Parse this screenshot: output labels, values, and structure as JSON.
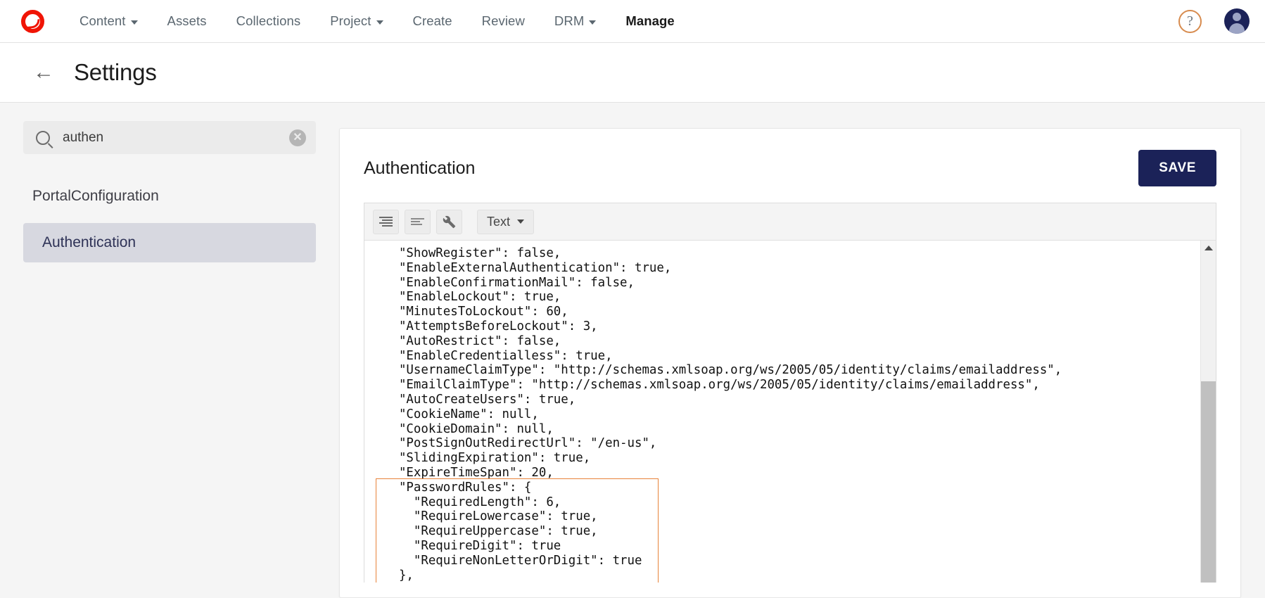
{
  "topnav": {
    "logo_name": "company-logo",
    "items": [
      {
        "label": "Content",
        "has_caret": true,
        "active": false
      },
      {
        "label": "Assets",
        "has_caret": false,
        "active": false
      },
      {
        "label": "Collections",
        "has_caret": false,
        "active": false
      },
      {
        "label": "Project",
        "has_caret": true,
        "active": false
      },
      {
        "label": "Create",
        "has_caret": false,
        "active": false
      },
      {
        "label": "Review",
        "has_caret": false,
        "active": false
      },
      {
        "label": "DRM",
        "has_caret": true,
        "active": false
      },
      {
        "label": "Manage",
        "has_caret": false,
        "active": true
      }
    ],
    "help_glyph": "?",
    "avatar_name": "user-avatar"
  },
  "pageheader": {
    "back_glyph": "←",
    "title": "Settings"
  },
  "sidebar": {
    "search": {
      "value": "authen",
      "placeholder": "Search",
      "clear_glyph": "✕"
    },
    "group_title": "PortalConfiguration",
    "items": [
      {
        "label": "Authentication",
        "selected": true
      }
    ]
  },
  "main": {
    "title": "Authentication",
    "save_label": "SAVE",
    "toolbar": {
      "buttons": [
        {
          "name": "indent-icon"
        },
        {
          "name": "align-icon"
        },
        {
          "name": "wrench-icon"
        }
      ],
      "select_label": "Text"
    },
    "code_lines": [
      "  \"ShowRegister\": false,",
      "  \"EnableExternalAuthentication\": true,",
      "  \"EnableConfirmationMail\": false,",
      "  \"EnableLockout\": true,",
      "  \"MinutesToLockout\": 60,",
      "  \"AttemptsBeforeLockout\": 3,",
      "  \"AutoRestrict\": false,",
      "  \"EnableCredentialless\": true,",
      "  \"UsernameClaimType\": \"http://schemas.xmlsoap.org/ws/2005/05/identity/claims/emailaddress\",",
      "  \"EmailClaimType\": \"http://schemas.xmlsoap.org/ws/2005/05/identity/claims/emailaddress\",",
      "  \"AutoCreateUsers\": true,",
      "  \"CookieName\": null,",
      "  \"CookieDomain\": null,",
      "  \"PostSignOutRedirectUrl\": \"/en-us\",",
      "  \"SlidingExpiration\": true,",
      "  \"ExpireTimeSpan\": 20,",
      "  \"PasswordRules\": {",
      "    \"RequiredLength\": 6,",
      "    \"RequireLowercase\": true,",
      "    \"RequireUppercase\": true,",
      "    \"RequireDigit\": true",
      "    \"RequireNonLetterOrDigit\": true",
      "  },"
    ],
    "highlight": {
      "color": "#e8833a",
      "start_line_index": 16,
      "end_line_index": 22
    },
    "scrollbar": {
      "up_arrow": "▲"
    }
  },
  "colors": {
    "accent_navy": "#1b2258",
    "logo_red": "#f01405",
    "highlight_orange": "#e8833a",
    "sidebar_selected": "#d7d8e0"
  }
}
